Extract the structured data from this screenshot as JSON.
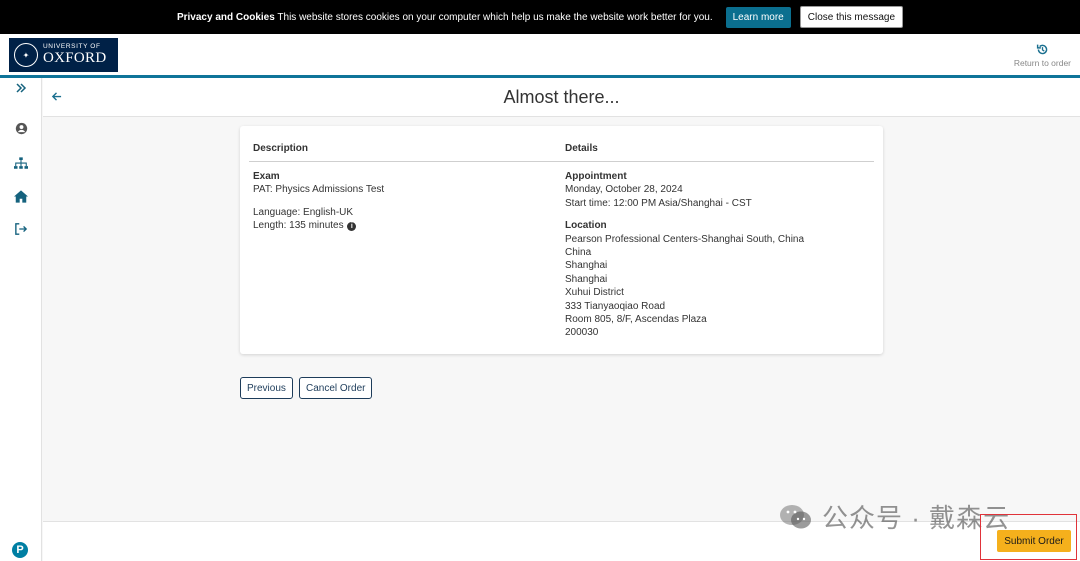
{
  "cookie_banner": {
    "title": "Privacy and Cookies",
    "message": "This website stores cookies on your computer which help us make the website work better for you.",
    "learn_more_label": "Learn more",
    "close_label": "Close this message"
  },
  "header": {
    "logo_line1": "UNIVERSITY OF",
    "logo_line2": "OXFORD",
    "return_label": "Return to order"
  },
  "page": {
    "title": "Almost there..."
  },
  "order_table": {
    "col_description": "Description",
    "col_details": "Details",
    "exam_heading": "Exam",
    "exam_name": "PAT: Physics Admissions Test",
    "language": "Language: English-UK",
    "length": "Length: 135 minutes",
    "appointment_heading": "Appointment",
    "appointment_date": "Monday, October 28, 2024",
    "start_time": "Start time: 12:00 PM Asia/Shanghai - CST",
    "location_heading": "Location",
    "location_lines": [
      "Pearson Professional Centers-Shanghai South, China",
      "China",
      "Shanghai",
      "Shanghai",
      "Xuhui District",
      "333 Tianyaoqiao Road",
      "Room 805, 8/F, Ascendas Plaza",
      "200030"
    ]
  },
  "actions": {
    "previous_label": "Previous",
    "cancel_label": "Cancel Order",
    "submit_label": "Submit Order"
  },
  "watermark": {
    "text": "公众号 · 戴森云"
  },
  "colors": {
    "brand_navy": "#002147",
    "accent_teal": "#0e7499",
    "submit_yellow": "#f5b01c",
    "highlight_red": "#e0333a"
  }
}
